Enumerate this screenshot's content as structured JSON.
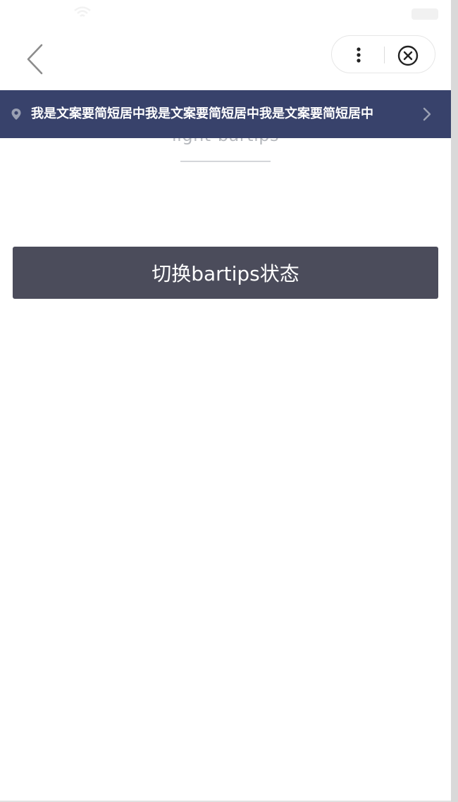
{
  "page": {
    "title": "light-bartips"
  },
  "bartips": {
    "text": "我是文案要简短居中我是文案要简短居中我是文案要简短居中",
    "background": "#38426b",
    "text_color": "#ffffff",
    "icon": "location-pin-icon",
    "arrow": "chevron-right-icon"
  },
  "main": {
    "toggle_button_label": "切换bartips状态",
    "button_color": "#4b4c5b"
  },
  "nav": {
    "back_icon": "chevron-left-icon",
    "menu_icon": "more-vertical-icon",
    "close_icon": "close-circle-icon"
  }
}
